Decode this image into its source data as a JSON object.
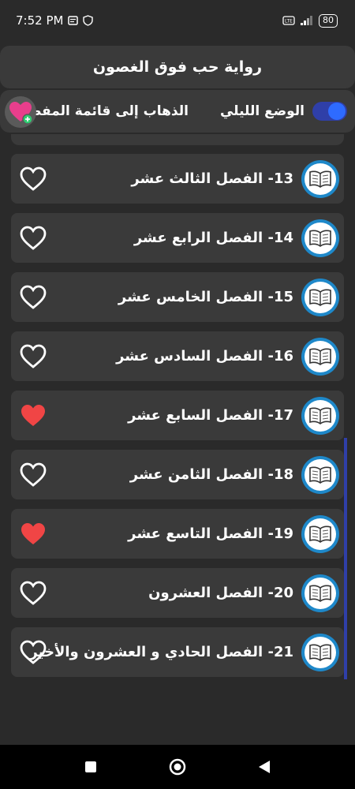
{
  "status_bar": {
    "time": "7:52 PM",
    "battery": "80"
  },
  "app": {
    "title": "رواية حب فوق الغصون"
  },
  "options": {
    "night_mode_label": "الوضع الليلي",
    "night_mode_on": true,
    "favorites_label": "الذهاب إلى قائمة المفضلة"
  },
  "chapters": [
    {
      "label": "13- الفصل الثالث عشر",
      "favorite": false
    },
    {
      "label": "14- الفصل الرابع عشر",
      "favorite": false
    },
    {
      "label": "15- الفصل الخامس عشر",
      "favorite": false
    },
    {
      "label": "16- الفصل السادس عشر",
      "favorite": false
    },
    {
      "label": "17- الفصل السابع عشر",
      "favorite": true
    },
    {
      "label": "18- الفصل الثامن عشر",
      "favorite": false
    },
    {
      "label": "19- الفصل التاسع عشر",
      "favorite": true
    },
    {
      "label": "20- الفصل العشرون",
      "favorite": false
    },
    {
      "label": "21- الفصل الحادي و العشرون والأخير",
      "favorite": false
    }
  ],
  "colors": {
    "background": "#2a2a2a",
    "card": "#3a3a3a",
    "accent": "#2e6bff",
    "heart_filled": "#f04545",
    "book_ring": "#1e88c9"
  }
}
